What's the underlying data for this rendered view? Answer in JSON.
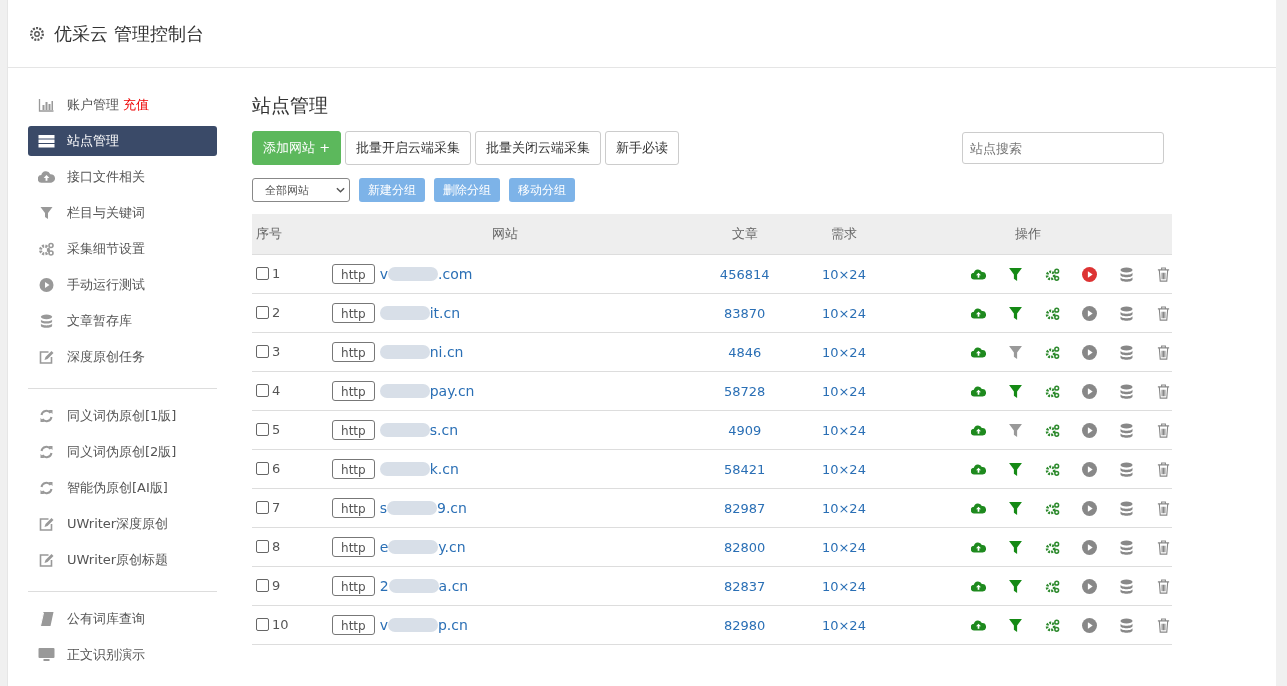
{
  "header": {
    "title": "优采云 管理控制台"
  },
  "sidebar": {
    "groups": [
      [
        {
          "kind": "chart",
          "label": "账户管理",
          "badge": "充值",
          "selected": false
        },
        {
          "kind": "server",
          "label": "站点管理",
          "selected": true
        },
        {
          "kind": "cloud",
          "label": "接口文件相关",
          "selected": false
        },
        {
          "kind": "filter",
          "label": "栏目与关键词",
          "selected": false
        },
        {
          "kind": "gears",
          "label": "采集细节设置",
          "selected": false
        },
        {
          "kind": "play",
          "label": "手动运行测试",
          "selected": false
        },
        {
          "kind": "database",
          "label": "文章暂存库",
          "selected": false
        },
        {
          "kind": "edit",
          "label": "深度原创任务",
          "selected": false
        }
      ],
      [
        {
          "kind": "refresh",
          "label": "同义词伪原创[1版]",
          "selected": false
        },
        {
          "kind": "refresh",
          "label": "同义词伪原创[2版]",
          "selected": false
        },
        {
          "kind": "refresh",
          "label": "智能伪原创[AI版]",
          "selected": false
        },
        {
          "kind": "edit",
          "label": "UWriter深度原创",
          "selected": false
        },
        {
          "kind": "edit",
          "label": "UWriter原创标题",
          "selected": false
        }
      ],
      [
        {
          "kind": "book",
          "label": "公有词库查询",
          "selected": false
        },
        {
          "kind": "monitor",
          "label": "正文识别演示",
          "selected": false
        }
      ]
    ]
  },
  "page_title": "站点管理",
  "toolbar": {
    "add_button": "添加网站 +",
    "buttons": [
      "批量开启云端采集",
      "批量关闭云端采集",
      "新手必读"
    ],
    "search": {
      "placeholder": "站点搜索"
    }
  },
  "group_bar": {
    "select": "全部网站",
    "buttons": [
      "新建分组",
      "删除分组",
      "移动分组"
    ]
  },
  "table": {
    "columns": [
      "序号",
      "网站",
      "文章",
      "需求",
      "操作"
    ],
    "rows": [
      {
        "no": "1",
        "checked": false,
        "protocol": "http",
        "domain_start": "v",
        "domain_end": ".com",
        "articles": "456814",
        "demand": "10×24",
        "filter_on": true,
        "running": true
      },
      {
        "no": "2",
        "checked": false,
        "protocol": "http",
        "domain_start": "",
        "domain_end": "it.cn",
        "articles": "83870",
        "demand": "10×24",
        "filter_on": true,
        "running": false
      },
      {
        "no": "3",
        "checked": false,
        "protocol": "http",
        "domain_start": "",
        "domain_end": "ni.cn",
        "articles": "4846",
        "demand": "10×24",
        "filter_on": false,
        "running": false
      },
      {
        "no": "4",
        "checked": false,
        "protocol": "http",
        "domain_start": "",
        "domain_end": "pay.cn",
        "articles": "58728",
        "demand": "10×24",
        "filter_on": true,
        "running": false
      },
      {
        "no": "5",
        "checked": false,
        "protocol": "http",
        "domain_start": "",
        "domain_end": "s.cn",
        "articles": "4909",
        "demand": "10×24",
        "filter_on": false,
        "running": false
      },
      {
        "no": "6",
        "checked": false,
        "protocol": "http",
        "domain_start": "",
        "domain_end": "k.cn",
        "articles": "58421",
        "demand": "10×24",
        "filter_on": true,
        "running": false
      },
      {
        "no": "7",
        "checked": false,
        "protocol": "http",
        "domain_start": "s",
        "domain_end": "9.cn",
        "articles": "82987",
        "demand": "10×24",
        "filter_on": true,
        "running": false
      },
      {
        "no": "8",
        "checked": false,
        "protocol": "http",
        "domain_start": "e",
        "domain_end": "y.cn",
        "articles": "82800",
        "demand": "10×24",
        "filter_on": true,
        "running": false
      },
      {
        "no": "9",
        "checked": false,
        "protocol": "http",
        "domain_start": "2",
        "domain_end": "a.cn",
        "articles": "82837",
        "demand": "10×24",
        "filter_on": true,
        "running": false
      },
      {
        "no": "10",
        "checked": false,
        "protocol": "http",
        "domain_start": "v",
        "domain_end": "p.cn",
        "articles": "82980",
        "demand": "10×24",
        "filter_on": true,
        "running": false
      }
    ]
  }
}
